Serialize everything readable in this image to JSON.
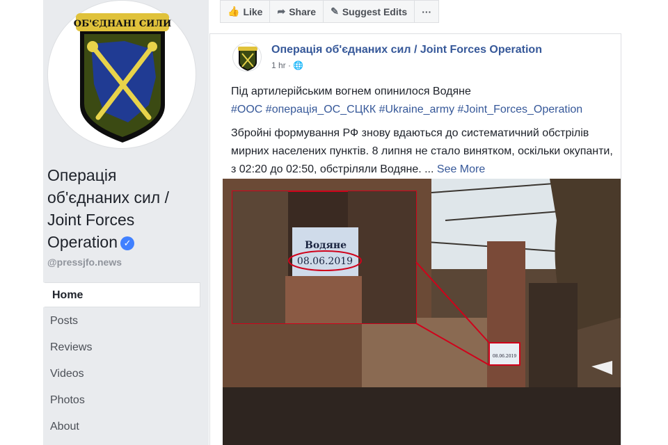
{
  "page": {
    "name": "Операція об'єднаних сил / Joint Forces Operation",
    "handle": "@pressjfo.news",
    "logo_text": "ОБ'ЄДНАНІ СИЛИ"
  },
  "nav": {
    "items": [
      {
        "label": "Home",
        "active": true
      },
      {
        "label": "Posts"
      },
      {
        "label": "Reviews"
      },
      {
        "label": "Videos"
      },
      {
        "label": "Photos"
      },
      {
        "label": "About"
      }
    ]
  },
  "actions": {
    "like": "Like",
    "share": "Share",
    "suggest": "Suggest Edits",
    "more": "···"
  },
  "post": {
    "author": "Операція об'єднаних сил / Joint Forces Operation",
    "time": "1 hr ·",
    "headline": "Під артилерійським вогнем опинилося Водяне",
    "hashtags": "#ООС #операція_ОС_СЦКК #Ukraine_army #Joint_Forces_Operation",
    "body": "Збройні формування РФ знову вдаються до систематичний обстрілів мирних населених пунктів. 8 липня не стало винятком, оскільки окупанти, з 02:20 до 02:50, обстріляли Водяне. ...",
    "see_more": "See More",
    "image": {
      "sign_text": "Водяне",
      "sign_date": "08.06.2019"
    }
  },
  "colors": {
    "link": "#365899",
    "sidebar_bg": "#e9ebee",
    "verified": "#4080ff",
    "highlight": "#d0021b"
  }
}
